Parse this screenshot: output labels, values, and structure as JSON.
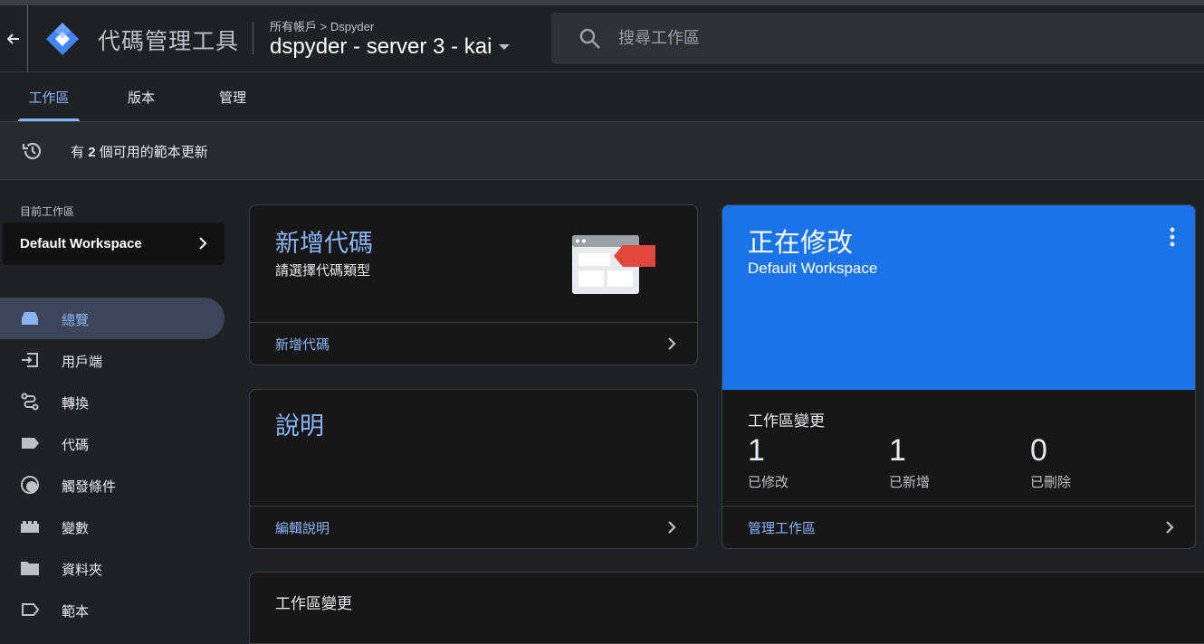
{
  "header": {
    "app_title": "代碼管理工具",
    "breadcrumb": "所有帳戶 > Dspyder",
    "container_name": "dspyder - server 3 - kai",
    "search_placeholder": "搜尋工作區"
  },
  "tabs": [
    {
      "label": "工作區",
      "active": true
    },
    {
      "label": "版本",
      "active": false
    },
    {
      "label": "管理",
      "active": false
    }
  ],
  "notice": {
    "prefix": "有",
    "count": "2",
    "suffix": "個可用的範本更新"
  },
  "sidebar": {
    "workspace_label": "目前工作區",
    "workspace_name": "Default Workspace",
    "items": [
      {
        "label": "總覽",
        "icon": "overview-icon",
        "active": true
      },
      {
        "label": "用戶端",
        "icon": "client-icon",
        "active": false
      },
      {
        "label": "轉換",
        "icon": "transformation-icon",
        "active": false
      },
      {
        "label": "代碼",
        "icon": "tag-icon",
        "active": false
      },
      {
        "label": "觸發條件",
        "icon": "trigger-icon",
        "active": false
      },
      {
        "label": "變數",
        "icon": "variable-icon",
        "active": false
      },
      {
        "label": "資料夾",
        "icon": "folder-icon",
        "active": false
      },
      {
        "label": "範本",
        "icon": "template-icon",
        "active": false
      }
    ]
  },
  "new_tag_card": {
    "title": "新增代碼",
    "subtitle": "請選擇代碼類型",
    "footer": "新增代碼"
  },
  "description_card": {
    "title": "說明",
    "footer": "編輯說明"
  },
  "editing_card": {
    "title": "正在修改",
    "workspace": "Default Workspace",
    "changes_title": "工作區變更",
    "stats": [
      {
        "value": "1",
        "label": "已修改"
      },
      {
        "value": "1",
        "label": "已新增"
      },
      {
        "value": "0",
        "label": "已刪除"
      }
    ],
    "footer": "管理工作區"
  },
  "workspace_changes_card": {
    "title": "工作區變更"
  },
  "colors": {
    "accent": "#8ab4f8",
    "brand_blue": "#1a73e8",
    "background": "#202124",
    "card": "#171717"
  }
}
